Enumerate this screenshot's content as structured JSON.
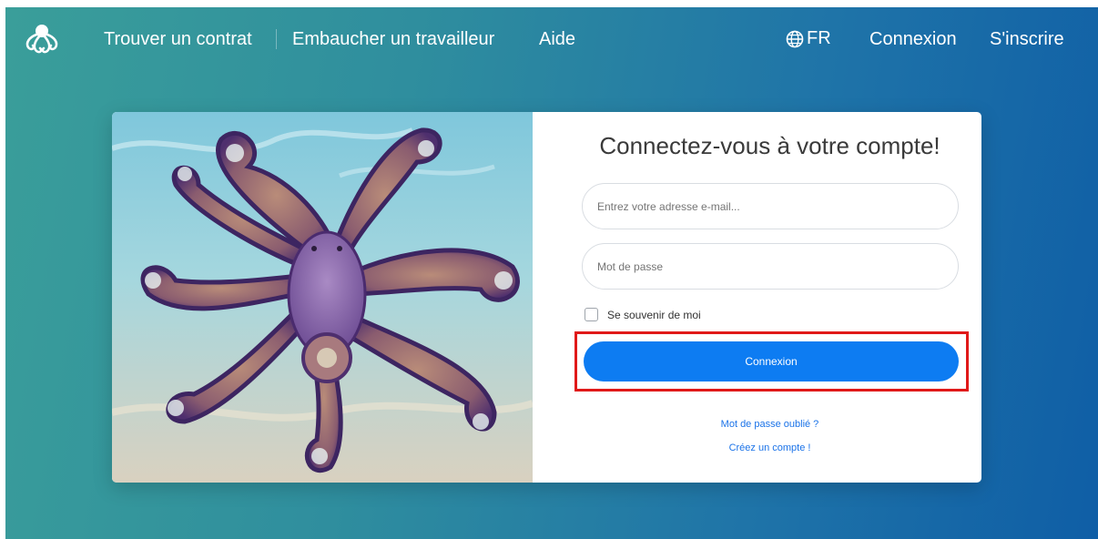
{
  "nav": {
    "links": [
      "Trouver un contrat",
      "Embaucher un travailleur",
      "Aide"
    ],
    "language": "FR",
    "login": "Connexion",
    "signup": "S'inscrire"
  },
  "login": {
    "title": "Connectez-vous à votre compte!",
    "email_placeholder": "Entrez votre adresse e-mail...",
    "password_placeholder": "Mot de passe",
    "remember_label": "Se souvenir de moi",
    "submit_label": "Connexion",
    "forgot_link": "Mot de passe oublié ?",
    "create_link": "Créez un compte !"
  },
  "icons": {
    "logo": "octopus-logo",
    "language": "globe-icon"
  },
  "colors": {
    "primary_button": "#0d7cf2",
    "link": "#1b73e8",
    "highlight_box": "#e01919"
  }
}
